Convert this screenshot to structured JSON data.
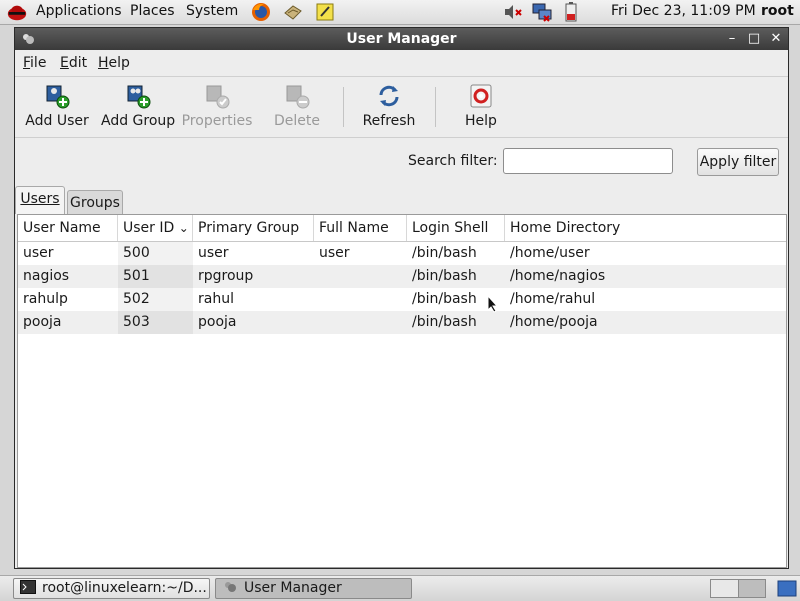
{
  "panel": {
    "menus": [
      "Applications",
      "Places",
      "System"
    ],
    "clock": "Fri Dec 23, 11:09 PM",
    "user": "root"
  },
  "window": {
    "title": "User Manager",
    "controls": {
      "minimize": "–",
      "maximize": "□",
      "close": "✕"
    }
  },
  "menubar": {
    "file": {
      "accel": "F",
      "rest": "ile"
    },
    "edit": {
      "accel": "E",
      "rest": "dit"
    },
    "help": {
      "accel": "H",
      "rest": "elp"
    }
  },
  "toolbar": {
    "add_user": "Add User",
    "add_group": "Add Group",
    "properties": "Properties",
    "delete": "Delete",
    "refresh": "Refresh",
    "help": "Help"
  },
  "search": {
    "label": "Search filter:",
    "value": "",
    "apply_label": "Apply filter"
  },
  "tabs": {
    "users": "Users",
    "groups": "Groups"
  },
  "table": {
    "columns": [
      "User Name",
      "User ID",
      "Primary Group",
      "Full Name",
      "Login Shell",
      "Home Directory"
    ],
    "sort_indicator": "⌄",
    "rows": [
      [
        "user",
        "500",
        "user",
        "user",
        "/bin/bash",
        "/home/user"
      ],
      [
        "nagios",
        "501",
        "rpgroup",
        "",
        "/bin/bash",
        "/home/nagios"
      ],
      [
        "rahulp",
        "502",
        "rahul",
        "",
        "/bin/bash",
        "/home/rahul"
      ],
      [
        "pooja",
        "503",
        "pooja",
        "",
        "/bin/bash",
        "/home/pooja"
      ]
    ]
  },
  "taskbar": {
    "terminal": "root@linuxelearn:~/D...",
    "user_manager": "User Manager"
  },
  "colors": {
    "titlebar": "#3a3a3a",
    "row_alt": "#efefef",
    "icon_blue": "#2d5e9e",
    "icon_green": "#2a9d2a"
  },
  "icons": [
    "redhat-logo",
    "firefox-icon",
    "mail-icon",
    "notes-icon",
    "volume-muted-icon",
    "network-icon",
    "battery-icon"
  ]
}
